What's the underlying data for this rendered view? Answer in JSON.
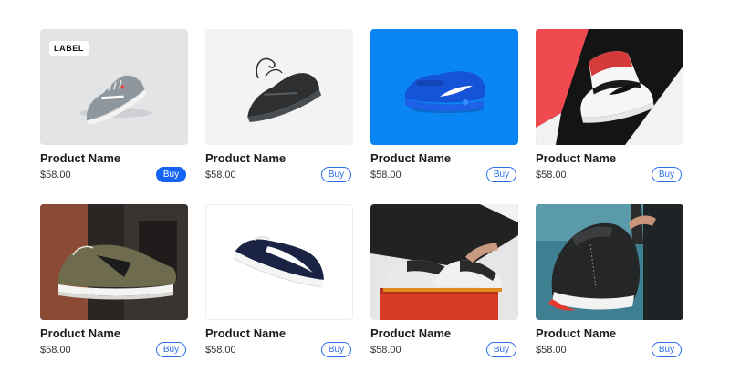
{
  "colors": {
    "accent": "#1463f3",
    "outline": "#2f6fea"
  },
  "products": [
    {
      "name": "Product Name",
      "price": "$58.00",
      "buy_label": "Buy",
      "badge": "LABEL",
      "image": "grey-running-shoe"
    },
    {
      "name": "Product Name",
      "price": "$58.00",
      "buy_label": "Buy",
      "image": "black-running-shoe"
    },
    {
      "name": "Product Name",
      "price": "$58.00",
      "buy_label": "Buy",
      "image": "blue-air-max-shoe"
    },
    {
      "name": "Product Name",
      "price": "$58.00",
      "buy_label": "Buy",
      "image": "red-white-high-top-shoe"
    },
    {
      "name": "Product Name",
      "price": "$58.00",
      "buy_label": "Buy",
      "image": "olive-new-balance-shoe"
    },
    {
      "name": "Product Name",
      "price": "$58.00",
      "buy_label": "Buy",
      "image": "navy-puma-shoe"
    },
    {
      "name": "Product Name",
      "price": "$58.00",
      "buy_label": "Buy",
      "image": "pair-on-shoebox"
    },
    {
      "name": "Product Name",
      "price": "$58.00",
      "buy_label": "Buy",
      "image": "black-red-jordan-shoe"
    }
  ]
}
